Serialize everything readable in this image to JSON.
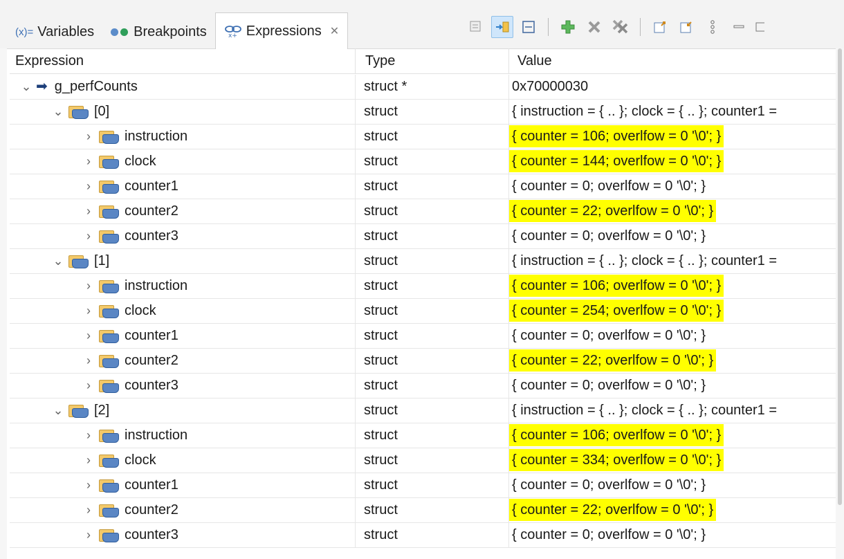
{
  "tabs": [
    {
      "label": "Variables",
      "icon": "variables-icon",
      "prefix": "(x)="
    },
    {
      "label": "Breakpoints",
      "icon": "breakpoints-icon"
    },
    {
      "label": "Expressions",
      "icon": "expressions-icon",
      "close": "✕"
    }
  ],
  "toolbar": [
    {
      "name": "collapse-all-icon"
    },
    {
      "name": "show-type-names-icon"
    },
    {
      "name": "layout-icon"
    },
    {
      "name": "add-expression-icon"
    },
    {
      "name": "remove-expression-icon"
    },
    {
      "name": "remove-all-icon"
    },
    {
      "name": "export-icon"
    },
    {
      "name": "import-icon"
    },
    {
      "name": "view-menu-icon"
    },
    {
      "name": "minimize-icon"
    }
  ],
  "columns": {
    "expression": "Expression",
    "type": "Type",
    "value": "Value"
  },
  "rows": [
    {
      "level": 0,
      "twisty": "⌄",
      "name": "g_perfCounts",
      "type": "struct *",
      "value": "0x70000030",
      "highlight": false,
      "kind": "pointer"
    },
    {
      "level": 1,
      "twisty": "⌄",
      "name": "[0]",
      "type": "struct",
      "value": "{ instruction = { .. }; clock = { .. }; counter1 =",
      "highlight": false,
      "kind": "struct"
    },
    {
      "level": 2,
      "twisty": "›",
      "name": "instruction",
      "type": "struct",
      "value": "{ counter = 106; overlfow = 0 '\\0'; }",
      "highlight": true,
      "kind": "struct"
    },
    {
      "level": 2,
      "twisty": "›",
      "name": "clock",
      "type": "struct",
      "value": "{ counter = 144; overlfow = 0 '\\0'; }",
      "highlight": true,
      "kind": "struct"
    },
    {
      "level": 2,
      "twisty": "›",
      "name": "counter1",
      "type": "struct",
      "value": "{ counter = 0; overlfow = 0 '\\0'; }",
      "highlight": false,
      "kind": "struct"
    },
    {
      "level": 2,
      "twisty": "›",
      "name": "counter2",
      "type": "struct",
      "value": "{ counter = 22; overlfow = 0 '\\0'; }",
      "highlight": true,
      "kind": "struct"
    },
    {
      "level": 2,
      "twisty": "›",
      "name": "counter3",
      "type": "struct",
      "value": "{ counter = 0; overlfow = 0 '\\0'; }",
      "highlight": false,
      "kind": "struct"
    },
    {
      "level": 1,
      "twisty": "⌄",
      "name": "[1]",
      "type": "struct",
      "value": "{ instruction = { .. }; clock = { .. }; counter1 =",
      "highlight": false,
      "kind": "struct"
    },
    {
      "level": 2,
      "twisty": "›",
      "name": "instruction",
      "type": "struct",
      "value": "{ counter = 106; overlfow = 0 '\\0'; }",
      "highlight": true,
      "kind": "struct"
    },
    {
      "level": 2,
      "twisty": "›",
      "name": "clock",
      "type": "struct",
      "value": "{ counter = 254; overlfow = 0 '\\0'; }",
      "highlight": true,
      "kind": "struct"
    },
    {
      "level": 2,
      "twisty": "›",
      "name": "counter1",
      "type": "struct",
      "value": "{ counter = 0; overlfow = 0 '\\0'; }",
      "highlight": false,
      "kind": "struct"
    },
    {
      "level": 2,
      "twisty": "›",
      "name": "counter2",
      "type": "struct",
      "value": "{ counter = 22; overlfow = 0 '\\0'; }",
      "highlight": true,
      "kind": "struct"
    },
    {
      "level": 2,
      "twisty": "›",
      "name": "counter3",
      "type": "struct",
      "value": "{ counter = 0; overlfow = 0 '\\0'; }",
      "highlight": false,
      "kind": "struct"
    },
    {
      "level": 1,
      "twisty": "⌄",
      "name": "[2]",
      "type": "struct",
      "value": "{ instruction = { .. }; clock = { .. }; counter1 =",
      "highlight": false,
      "kind": "struct"
    },
    {
      "level": 2,
      "twisty": "›",
      "name": "instruction",
      "type": "struct",
      "value": "{ counter = 106; overlfow = 0 '\\0'; }",
      "highlight": true,
      "kind": "struct"
    },
    {
      "level": 2,
      "twisty": "›",
      "name": "clock",
      "type": "struct",
      "value": "{ counter = 334; overlfow = 0 '\\0'; }",
      "highlight": true,
      "kind": "struct"
    },
    {
      "level": 2,
      "twisty": "›",
      "name": "counter1",
      "type": "struct",
      "value": "{ counter = 0; overlfow = 0 '\\0'; }",
      "highlight": false,
      "kind": "struct"
    },
    {
      "level": 2,
      "twisty": "›",
      "name": "counter2",
      "type": "struct",
      "value": "{ counter = 22; overlfow = 0 '\\0'; }",
      "highlight": true,
      "kind": "struct"
    },
    {
      "level": 2,
      "twisty": "›",
      "name": "counter3",
      "type": "struct",
      "value": "{ counter = 0; overlfow = 0 '\\0'; }",
      "highlight": false,
      "kind": "struct"
    }
  ],
  "colors": {
    "highlight": "#ffff00",
    "tab_border": "#cfcfcf",
    "pressed": "#cfe6fb"
  }
}
